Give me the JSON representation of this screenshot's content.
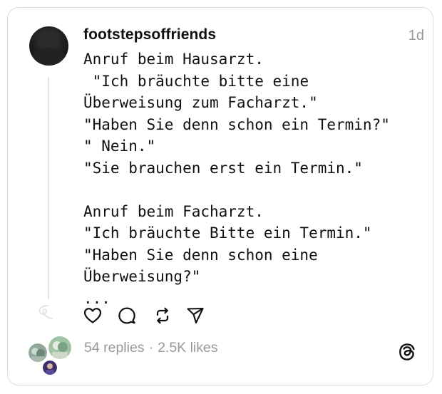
{
  "post": {
    "username": "footstepsoffriends",
    "time": "1d",
    "text_lines": [
      "Anruf beim Hausarzt.",
      " \"Ich bräuchte bitte eine Überweisung zum Facharzt.\"",
      "\"Haben Sie denn schon ein Termin?\"",
      "\" Nein.\"",
      "\"Sie brauchen erst ein Termin.\"",
      "",
      "Anruf beim Facharzt.",
      "\"Ich bräuchte Bitte ein Termin.\"",
      "\"Haben Sie denn schon eine Überweisung?\"",
      "..."
    ],
    "replies": "54 replies",
    "separator": "·",
    "likes": "2.5K likes"
  },
  "icons": {
    "like": "heart-icon",
    "comment": "comment-icon",
    "repost": "repost-icon",
    "share": "share-icon",
    "app": "threads-logo-icon"
  },
  "colors": {
    "text": "#101010",
    "muted": "#999999",
    "border": "#dcdcdc",
    "thread_line": "#e4e4e4"
  }
}
